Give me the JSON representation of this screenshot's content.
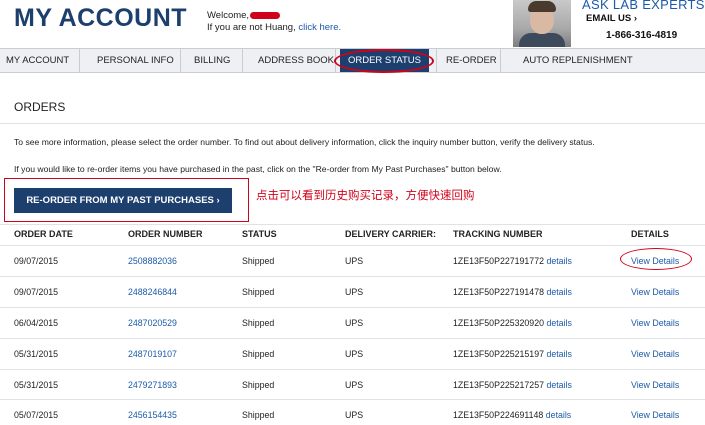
{
  "header": {
    "title": "MY ACCOUNT",
    "welcome_label": "Welcome,",
    "not_user_text": "If you are not Huang,",
    "click_here": "click here.",
    "ask_lab_experts": "ASK LAB EXPERTS",
    "email_us": "EMAIL US ›",
    "phone": "1-866-316-4819"
  },
  "nav": {
    "items": [
      "MY ACCOUNT",
      "PERSONAL INFO",
      "BILLING",
      "ADDRESS BOOK",
      "ORDER STATUS",
      "RE-ORDER",
      "AUTO REPLENISHMENT"
    ],
    "active": "ORDER STATUS"
  },
  "orders": {
    "heading": "ORDERS",
    "info_1": "To see more information, please select the order number. To find out about delivery information, click the inquiry number button, verify the delivery status.",
    "info_2": "If you would like to re-order items you have purchased in the past, click on the \"Re-order from My Past Purchases\" button below.",
    "reorder_button": "RE-ORDER FROM MY PAST PURCHASES  ›",
    "annotation": "点击可以看到历史购买记录，方便快速回购",
    "columns": [
      "ORDER DATE",
      "ORDER NUMBER",
      "STATUS",
      "DELIVERY CARRIER:",
      "TRACKING NUMBER",
      "DETAILS"
    ],
    "rows": [
      {
        "date": "09/07/2015",
        "number": "2508882036",
        "status": "Shipped",
        "carrier": "UPS",
        "tracking": "1ZE13F50P227191772",
        "tracking_link": "details",
        "details": "View Details"
      },
      {
        "date": "09/07/2015",
        "number": "2488246844",
        "status": "Shipped",
        "carrier": "UPS",
        "tracking": "1ZE13F50P227191478",
        "tracking_link": "details",
        "details": "View Details"
      },
      {
        "date": "06/04/2015",
        "number": "2487020529",
        "status": "Shipped",
        "carrier": "UPS",
        "tracking": "1ZE13F50P225320920",
        "tracking_link": "details",
        "details": "View Details"
      },
      {
        "date": "05/31/2015",
        "number": "2487019107",
        "status": "Shipped",
        "carrier": "UPS",
        "tracking": "1ZE13F50P225215197",
        "tracking_link": "details",
        "details": "View Details"
      },
      {
        "date": "05/31/2015",
        "number": "2479271893",
        "status": "Shipped",
        "carrier": "UPS",
        "tracking": "1ZE13F50P225217257",
        "tracking_link": "details",
        "details": "View Details"
      },
      {
        "date": "05/07/2015",
        "number": "2456154435",
        "status": "Shipped",
        "carrier": "UPS",
        "tracking": "1ZE13F50P224691148",
        "tracking_link": "details",
        "details": "View Details"
      }
    ]
  },
  "colors": {
    "brand_navy": "#1d3f6e",
    "link_blue": "#1d5aa8",
    "annotation_red": "#d0021b"
  }
}
